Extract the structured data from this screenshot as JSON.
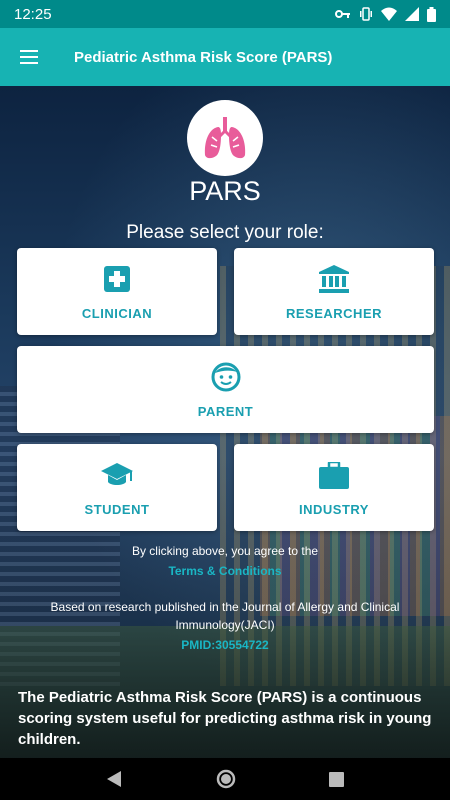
{
  "status_bar": {
    "time": "12:25"
  },
  "app_bar": {
    "title": "Pediatric Asthma Risk Score (PARS)"
  },
  "main": {
    "app_name": "PARS",
    "role_prompt": "Please select your role:",
    "roles": [
      {
        "label": "CLINICIAN",
        "icon": "medical-cross-icon"
      },
      {
        "label": "RESEARCHER",
        "icon": "institution-icon"
      },
      {
        "label": "PARENT",
        "icon": "child-face-icon"
      },
      {
        "label": "STUDENT",
        "icon": "graduation-cap-icon"
      },
      {
        "label": "INDUSTRY",
        "icon": "briefcase-icon"
      }
    ],
    "agree_text": "By clicking above, you agree to the",
    "terms_link": "Terms & Conditions",
    "research_text": "Based on research published in the Journal of Allergy and Clinical Immunology(JACI)",
    "pmid_link": "PMID:30554722",
    "description": "The Pediatric Asthma Risk Score (PARS) is a continuous scoring system useful for predicting asthma risk in young children."
  },
  "colors": {
    "primary": "#17b3b3",
    "status_bar": "#008a8a",
    "accent": "#1a9fb0",
    "logo_lungs": "#e85c9a"
  }
}
